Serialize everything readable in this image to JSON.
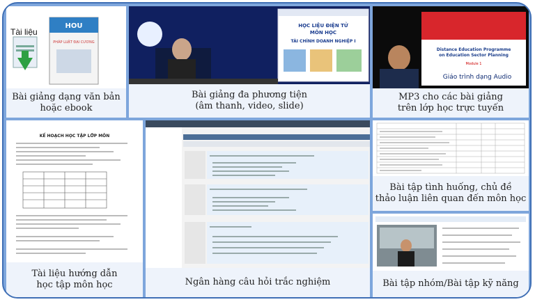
{
  "tiles": [
    {
      "caption_line1": "Bài giảng dạng văn bản",
      "caption_line2": "hoặc ebook",
      "tag": "Tài liệu",
      "logo": "HOU",
      "book_title": "PHÁP LUẬT ĐẠI CƯƠNG"
    },
    {
      "caption_line1": "Bài giảng đa phương tiện",
      "caption_line2": "(âm thanh, video, slide)",
      "slide_line1": "HỌC LIỆU ĐIỆN TỬ",
      "slide_line2": "MÔN HỌC",
      "slide_line3": "TÀI CHÍNH DOANH NGHIỆP I"
    },
    {
      "caption_line1": "MP3 cho các bài giảng",
      "caption_line2": "trên lớp học trực tuyến",
      "book_title1": "Distance Education Programme",
      "book_title2": "on Education Sector Planning",
      "module": "Module 1",
      "audio_label": "Giáo trình dạng Audio"
    },
    {
      "caption_line1": "Tài liệu hướng dẫn",
      "caption_line2": "học tập môn học",
      "doc_title": "KẾ HOẠCH HỌC TẬP LỚP MÔN"
    },
    {
      "caption_line1": "Ngân hàng câu hỏi trắc nghiệm",
      "caption_line2": ""
    },
    {
      "caption_line1": "Bài tập tình huống, chủ đề",
      "caption_line2": "thảo luận liên quan đến môn học"
    },
    {
      "caption_line1": "Bài tập nhóm/Bài tập kỹ năng",
      "caption_line2": ""
    }
  ]
}
